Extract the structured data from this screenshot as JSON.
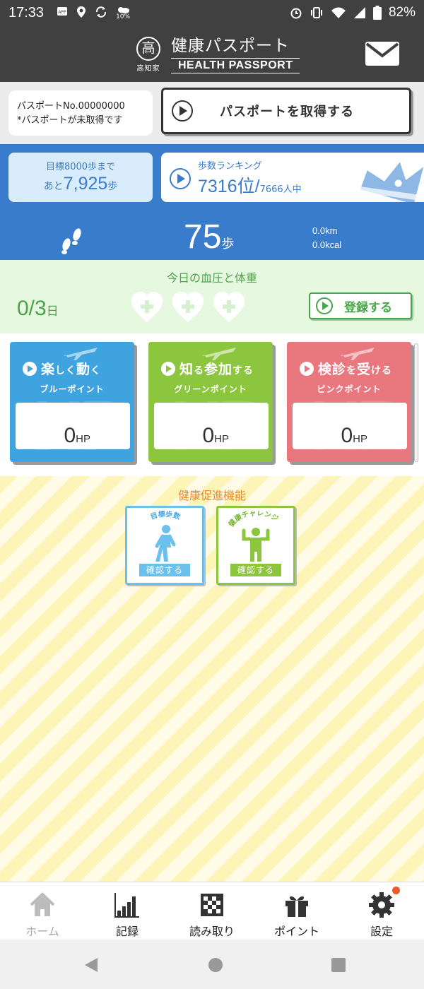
{
  "status_bar": {
    "time": "17:33",
    "left_icons": [
      "app-icon",
      "location-icon",
      "sync-icon",
      "weather-icon"
    ],
    "weather_pct": "10%",
    "battery_pct": "82%",
    "right_icons": [
      "alarm-icon",
      "vibrate-icon",
      "wifi-icon",
      "signal-icon",
      "battery-icon"
    ]
  },
  "header": {
    "logo_char": "高",
    "logo_caption": "高知家",
    "title_jp": "健康パスポート",
    "title_en": "HEALTH PASSPORT",
    "mail_icon": "mail-icon"
  },
  "passport": {
    "number_text": "パスポートNo.00000000",
    "status_text": "*パスポートが未取得です",
    "get_button_label": "パスポートを取得する"
  },
  "steps": {
    "goal_label": "目標8000歩まで",
    "goal_prefix": "あと",
    "goal_remaining": "7,925",
    "goal_unit": "歩",
    "ranking_label": "歩数ランキング",
    "rank_value": "7316位",
    "rank_slash": "/",
    "rank_total": "7666人中",
    "today_steps": "75",
    "steps_unit": "歩",
    "distance": "0.0km",
    "calories": "0.0kcal"
  },
  "blood_pressure": {
    "title": "今日の血圧と体重",
    "count": "0/3",
    "count_unit": "日",
    "hearts_filled": 0,
    "hearts_total": 3,
    "register_label": "登録する"
  },
  "point_cards": [
    {
      "title_a": "楽",
      "title_b": "しく",
      "title_c": "動",
      "title_d": "く",
      "subtitle": "ブルーポイント",
      "value": "0",
      "unit": "HP",
      "color": "#3fa3e0"
    },
    {
      "title_a": "知",
      "title_b": "る",
      "title_c": "参加",
      "title_d": "する",
      "subtitle": "グリーンポイント",
      "value": "0",
      "unit": "HP",
      "color": "#8cc63f"
    },
    {
      "title_a": "検診",
      "title_b": "を",
      "title_c": "受",
      "title_d": "ける",
      "subtitle": "ピンクポイント",
      "value": "0",
      "unit": "HP",
      "color": "#e8777e"
    }
  ],
  "promo": {
    "title": "健康促進機能",
    "tiles": [
      {
        "caption": "目標歩数",
        "button": "確認する",
        "icon": "walking-person-icon"
      },
      {
        "caption": "健康チャレンジ",
        "button": "確認する",
        "icon": "flexing-person-icon"
      }
    ]
  },
  "bottom_nav": [
    {
      "label": "ホーム",
      "icon": "home-icon",
      "active": true
    },
    {
      "label": "記録",
      "icon": "bar-chart-icon",
      "active": false
    },
    {
      "label": "読み取り",
      "icon": "qr-code-icon",
      "active": false
    },
    {
      "label": "ポイント",
      "icon": "gift-icon",
      "active": false
    },
    {
      "label": "設定",
      "icon": "gear-icon",
      "active": false,
      "badge": true
    }
  ],
  "colors": {
    "header_bg": "#404040",
    "steps_blue": "#3a7ccc",
    "bp_green": "#4aa448",
    "promo_orange": "#e88a2c",
    "badge_orange": "#ef5a2a"
  }
}
